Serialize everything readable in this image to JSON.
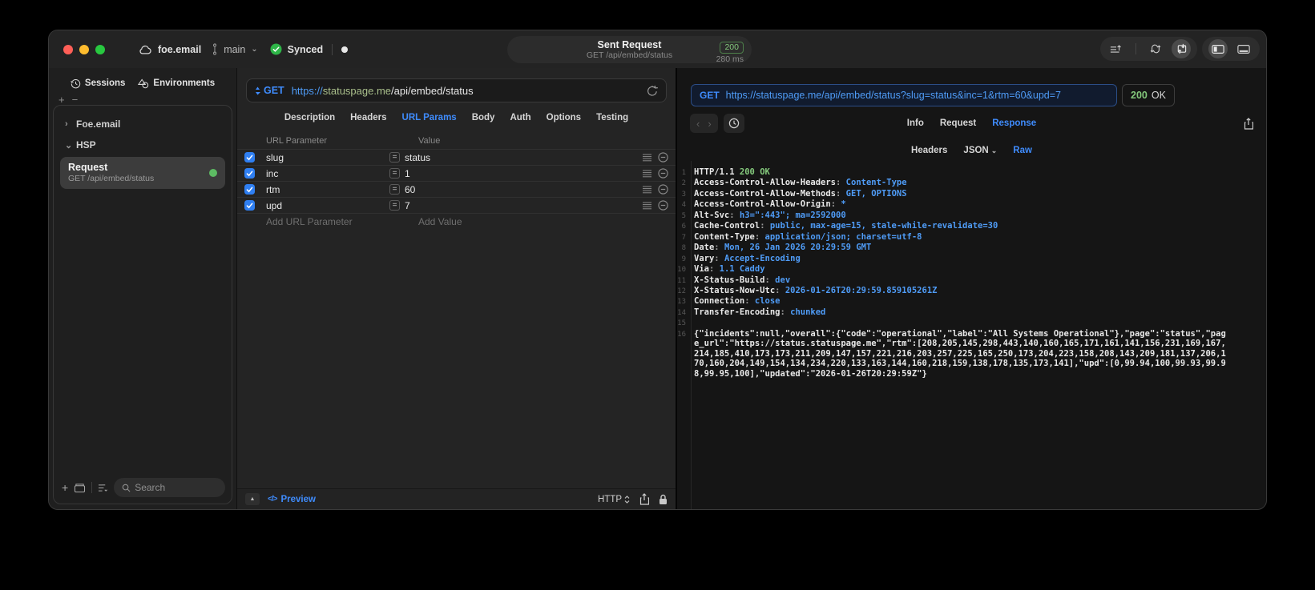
{
  "titlebar": {
    "project": "foe.email",
    "branch": "main",
    "sync_status": "Synced",
    "request_summary": {
      "title": "Sent Request",
      "subtitle": "GET /api/embed/status",
      "status_code": "200",
      "duration": "280 ms"
    }
  },
  "sidebar": {
    "tabs": [
      {
        "label": "Sessions"
      },
      {
        "label": "Environments"
      }
    ],
    "tree": [
      {
        "label": "Foe.email",
        "state": "collapsed"
      },
      {
        "label": "HSP",
        "state": "expanded"
      }
    ],
    "request_item": {
      "title": "Request",
      "subtitle": "GET /api/embed/status"
    },
    "search_placeholder": "Search"
  },
  "request_editor": {
    "method": "GET",
    "url_scheme": "https://",
    "url_host": "statuspage.me",
    "url_path": "/api/embed/status",
    "tabs": [
      {
        "label": "Description"
      },
      {
        "label": "Headers"
      },
      {
        "label": "URL Params",
        "active": true
      },
      {
        "label": "Body"
      },
      {
        "label": "Auth"
      },
      {
        "label": "Options"
      },
      {
        "label": "Testing"
      }
    ],
    "table": {
      "columns": [
        "URL Parameter",
        "Value"
      ],
      "rows": [
        {
          "name": "slug",
          "value": "status",
          "enabled": true
        },
        {
          "name": "inc",
          "value": "1",
          "enabled": true
        },
        {
          "name": "rtm",
          "value": "60",
          "enabled": true
        },
        {
          "name": "upd",
          "value": "7",
          "enabled": true
        }
      ],
      "add_name_placeholder": "Add URL Parameter",
      "add_value_placeholder": "Add Value"
    },
    "footer": {
      "preview_label": "Preview",
      "protocol_label": "HTTP"
    }
  },
  "response_viewer": {
    "method": "GET",
    "url": "https://statuspage.me/api/embed/status?slug=status&inc=1&rtm=60&upd=7",
    "status_code": "200",
    "status_text": "OK",
    "tabs": [
      {
        "label": "Info"
      },
      {
        "label": "Request"
      },
      {
        "label": "Response",
        "active": true
      }
    ],
    "subtabs": [
      {
        "label": "Headers"
      },
      {
        "label": "JSON",
        "chevron": true
      },
      {
        "label": "Raw",
        "active": true
      }
    ],
    "status_line": {
      "protocol": "HTTP/1.1",
      "status": "200 OK"
    },
    "headers": [
      {
        "key": "Access-Control-Allow-Headers",
        "value": "Content-Type"
      },
      {
        "key": "Access-Control-Allow-Methods",
        "value": "GET, OPTIONS"
      },
      {
        "key": "Access-Control-Allow-Origin",
        "value": "*"
      },
      {
        "key": "Alt-Svc",
        "value": "h3=\":443\"; ma=2592000"
      },
      {
        "key": "Cache-Control",
        "value": "public, max-age=15, stale-while-revalidate=30"
      },
      {
        "key": "Content-Type",
        "value": "application/json; charset=utf-8"
      },
      {
        "key": "Date",
        "value": "Mon, 26 Jan 2026 20:29:59 GMT"
      },
      {
        "key": "Vary",
        "value": "Accept-Encoding"
      },
      {
        "key": "Via",
        "value": "1.1 Caddy"
      },
      {
        "key": "X-Status-Build",
        "value": "dev"
      },
      {
        "key": "X-Status-Now-Utc",
        "value": "2026-01-26T20:29:59.859105261Z"
      },
      {
        "key": "Connection",
        "value": "close"
      },
      {
        "key": "Transfer-Encoding",
        "value": "chunked"
      }
    ],
    "body": "{\"incidents\":null,\"overall\":{\"code\":\"operational\",\"label\":\"All Systems Operational\"},\"page\":\"status\",\"page_url\":\"https://status.statuspage.me\",\"rtm\":[208,205,145,298,443,140,160,165,171,161,141,156,231,169,167,214,185,410,173,173,211,209,147,157,221,216,203,257,225,165,250,173,204,223,158,208,143,209,181,137,206,170,160,204,149,154,134,234,220,133,163,144,160,218,159,138,178,135,173,141],\"upd\":[0,99.94,100,99.93,99.98,99.95,100],\"updated\":\"2026-01-26T20:29:59Z\"}"
  },
  "icons": {
    "plus": "+",
    "minus": "−",
    "equals": "=",
    "triangle_up": "▲",
    "code": "</>",
    "dot": "●",
    "chevron_left": "‹",
    "chevron_right": "›",
    "chevron_down": "⌄",
    "tree_collapsed": "›",
    "tree_expanded": "⌄"
  },
  "colors": {
    "accent_blue": "#3f8cfd",
    "value_blue": "#4f9cf7",
    "host_green": "#a9bf8b",
    "status_green": "#84c97c",
    "checkbox_blue": "#2f7ff2",
    "sync_green": "#2eb548",
    "traffic_red": "#ff5f57",
    "traffic_yellow": "#febc2e",
    "traffic_green": "#28c840"
  }
}
